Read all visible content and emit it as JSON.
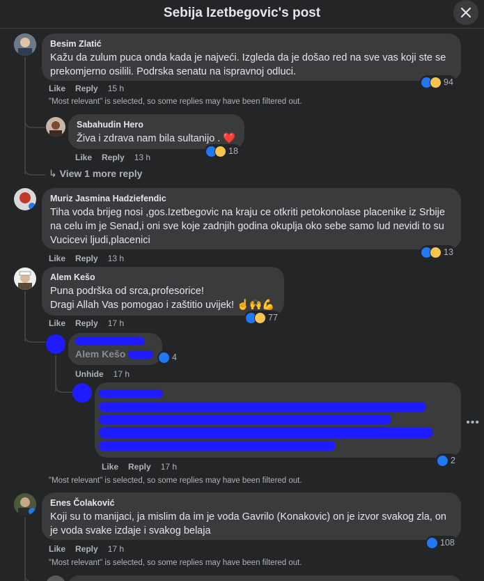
{
  "header": {
    "title": "Sebija Izetbegovic's post"
  },
  "comments": [
    {
      "author": "Besim Zlatić",
      "text": "Kažu da zulum puca onda kada je najveći. Izgleda da je došao red na sve vas koji ste se prekomjerno osilili. Podrska senatu na ispravnoj odluci.",
      "like": "Like",
      "reply": "Reply",
      "time": "15 h",
      "reactions": "94"
    },
    {
      "author": "Sabahudin Hero",
      "text": "Živa i zdrava nam bila sultanijo . ❤️",
      "like": "Like",
      "reply": "Reply",
      "time": "13 h",
      "reactions": "18"
    },
    {
      "author": "Muriz Jasmina Hadziefendic",
      "text": "Tiha voda brijeg nosi ,gos.Izetbegovic na kraju ce otkriti petokonolase placenike iz Srbije na celu im je Senad,i oni sve koje zadnjih godina okuplja oko sebe samo lud nevidi to su Vucicevi ljudi,placenici",
      "like": "Like",
      "reply": "Reply",
      "time": "13 h",
      "reactions": "13"
    },
    {
      "author": "Alem Kešo",
      "text_line1": "Puna podrška od srca,profesorice!",
      "text_line2": "Dragi Allah Vas pomogao i zaštitio uvijek! ☝️🙌💪",
      "like": "Like",
      "reply": "Reply",
      "time": "17 h",
      "reactions": "77"
    },
    {
      "author_redacted": "",
      "mention": "Alem Kešo",
      "unhide": "Unhide",
      "time": "17 h",
      "reactions": "4"
    },
    {
      "like": "Like",
      "reply": "Reply",
      "time": "17 h",
      "reactions": "2"
    },
    {
      "author": "Enes Čolaković",
      "text": "Koji su to manijaci, ja mislim da im je voda Gavrilo (Konakovic) on je izvor svakog zla, on je voda svake izdaje i svakog belaja",
      "like": "Like",
      "reply": "Reply",
      "time": "17 h",
      "reactions": "108"
    }
  ],
  "view_more": "View 1 more reply",
  "filter_note": "\"Most relevant\" is selected, so some replies may have been filtered out.",
  "colors": {
    "background": "#242526",
    "bubble": "#3a3b3c",
    "like": "#2078f4",
    "haha": "#f7c44e",
    "redaction": "#1f1bff"
  }
}
